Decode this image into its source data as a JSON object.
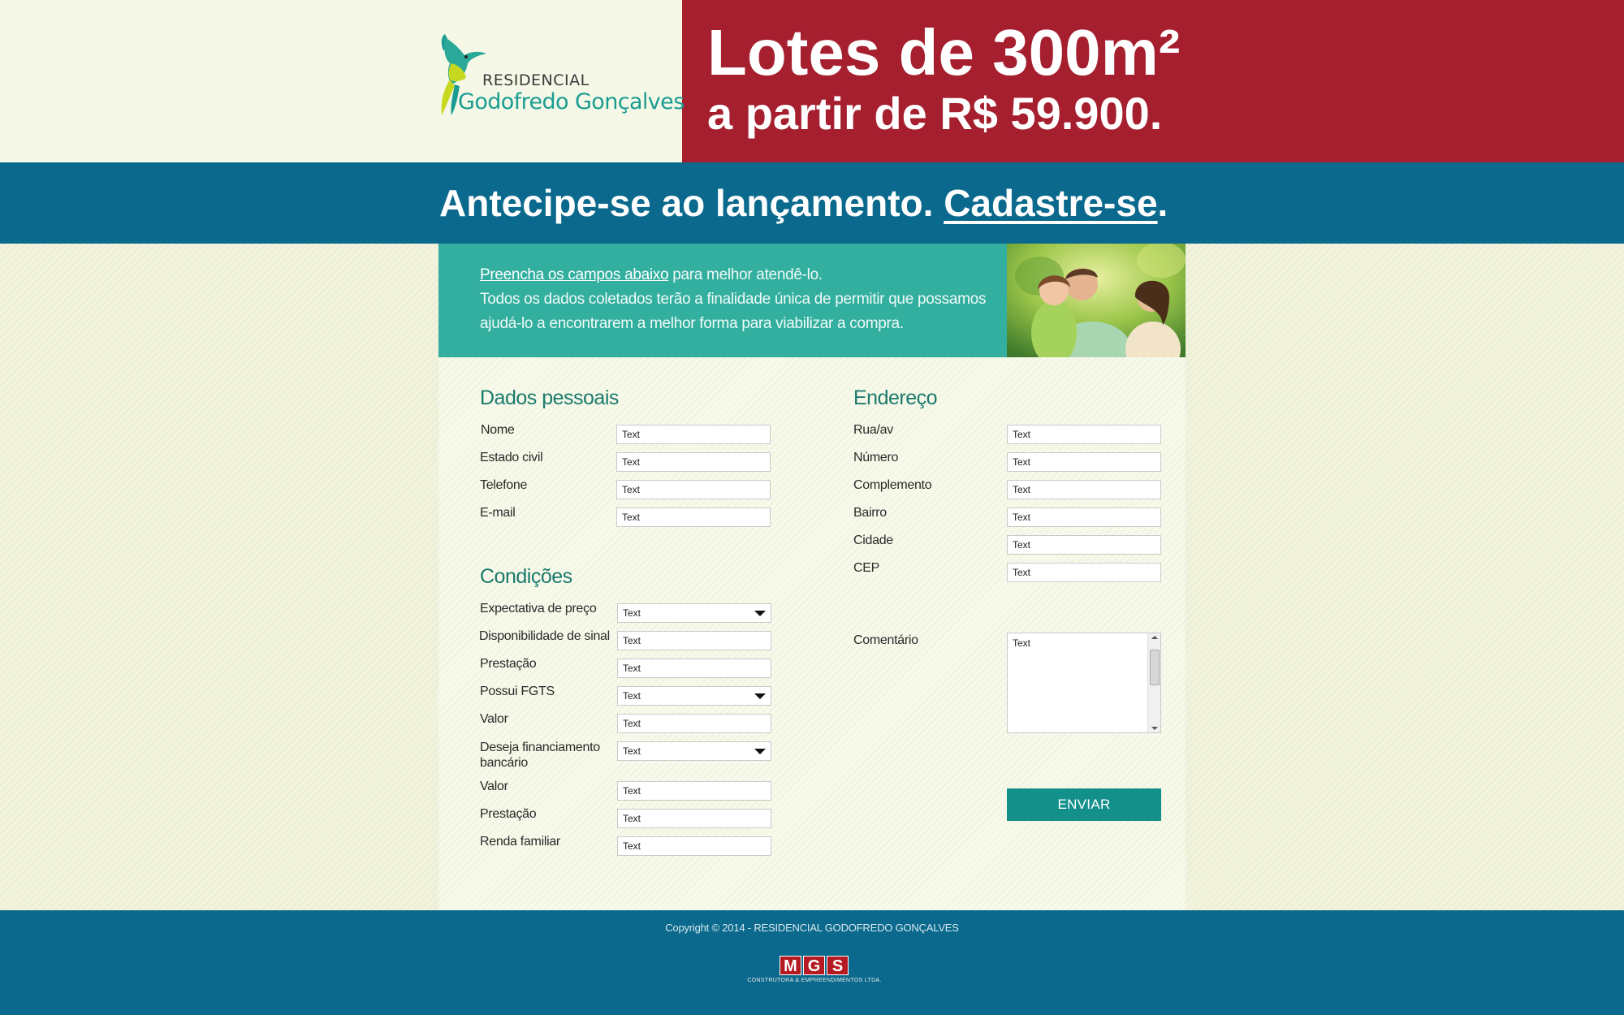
{
  "header": {
    "logo_small": "RESIDENCIAL",
    "logo_big": "Godofredo Gonçalves",
    "headline_line1": "Lotes de 300m²",
    "headline_line2": "a partir de R$ 59.900.",
    "colors": {
      "left_bg": "#f5f8e6",
      "right_bg": "#a61f2f"
    }
  },
  "band": {
    "text": "Antecipe-se ao lançamento. ",
    "link": "Cadastre-se",
    "period": ".",
    "color": "#0a698c"
  },
  "intro": {
    "link_text": "Preencha os campos abaixo",
    "line1_rest": " para melhor atendê-lo.",
    "line2": "Todos os dados coletados terão a finalidade única de permitir que possamos ajudá-lo a encontrarem a melhor forma para viabilizar a compra.",
    "color": "#33afa0"
  },
  "sections": {
    "dados": "Dados pessoais",
    "condicoes": "Condições",
    "endereco": "Endereço"
  },
  "dados_fields": [
    {
      "label": "Nome",
      "value": "Text"
    },
    {
      "label": "Estado civil",
      "value": "Text"
    },
    {
      "label": "Telefone",
      "value": "Text"
    },
    {
      "label": "E-mail",
      "value": "Text"
    }
  ],
  "condicoes_fields": [
    {
      "label": "Expectativa de preço",
      "value": "Text"
    },
    {
      "label": "Disponibilidade de sinal",
      "value": "Text"
    },
    {
      "label": "Prestação",
      "value": "Text"
    },
    {
      "label": "Possui FGTS",
      "value": "Text"
    },
    {
      "label": "Valor",
      "value": "Text"
    },
    {
      "label": "Deseja financiamento bancário",
      "value": "Text"
    },
    {
      "label": "Valor",
      "value": "Text"
    },
    {
      "label": "Prestação",
      "value": "Text"
    },
    {
      "label": "Renda familiar",
      "value": "Text"
    }
  ],
  "endereco_fields": [
    {
      "label": "Rua/av",
      "value": "Text"
    },
    {
      "label": "Número",
      "value": "Text"
    },
    {
      "label": "Complemento",
      "value": "Text"
    },
    {
      "label": "Bairro",
      "value": "Text"
    },
    {
      "label": "Cidade",
      "value": "Text"
    },
    {
      "label": "CEP",
      "value": "Text"
    }
  ],
  "comentario": {
    "label": "Comentário",
    "value": "Text"
  },
  "submit_label": "ENVIAR",
  "footer": {
    "copyright": "Copyright © 2014 - RESIDENCIAL GODOFREDO GONÇALVES",
    "logo_letters": [
      "M",
      "G",
      "S"
    ],
    "logo_sub": "CONSTRUTORA & EMPREENDIMENTOS LTDA."
  }
}
